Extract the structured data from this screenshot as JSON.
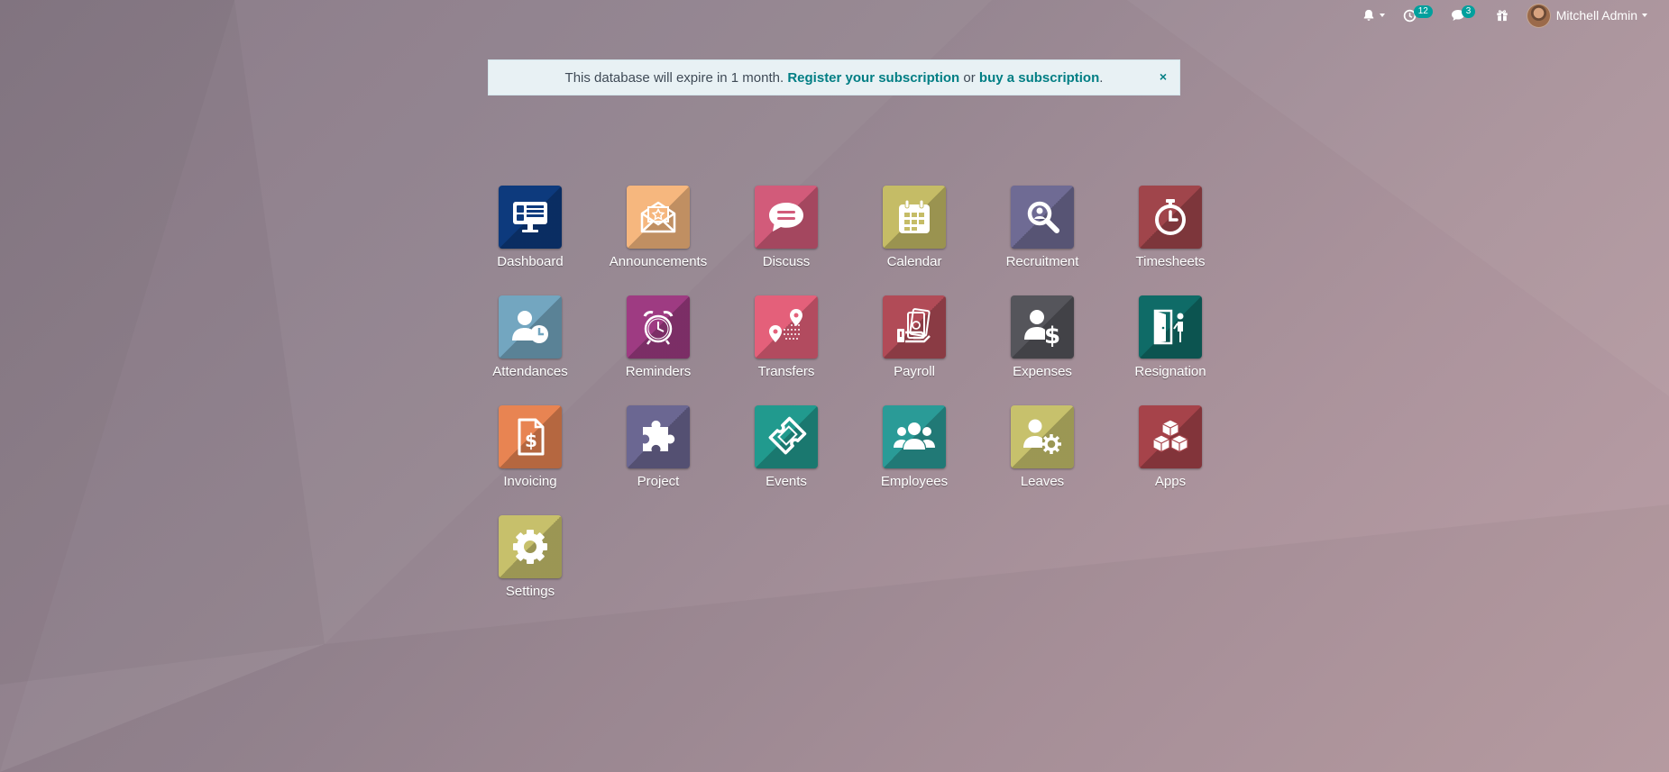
{
  "topbar": {
    "notifications_icon": "bell-icon",
    "activities_icon": "clock-icon",
    "activities_count": "12",
    "messages_icon": "chat-icon",
    "messages_count": "3",
    "gift_icon": "gift-icon",
    "user_name": "Mitchell Admin"
  },
  "alert": {
    "text_before": "This database will expire in 1 month.",
    "register_link": "Register your subscription",
    "text_or": "or",
    "buy_link": "buy a subscription",
    "text_after": ".",
    "close": "×"
  },
  "apps": [
    {
      "label": "Dashboard",
      "icon": "dashboard-icon",
      "color": "#0d3a7d"
    },
    {
      "label": "Announcements",
      "icon": "announcement-icon",
      "color": "#f6b77e"
    },
    {
      "label": "Discuss",
      "icon": "discuss-icon",
      "color": "#d25b7a"
    },
    {
      "label": "Calendar",
      "icon": "calendar-icon",
      "color": "#c5bc66"
    },
    {
      "label": "Recruitment",
      "icon": "recruitment-icon",
      "color": "#6f6b94"
    },
    {
      "label": "Timesheets",
      "icon": "stopwatch-icon",
      "color": "#a0454b"
    },
    {
      "label": "Attendances",
      "icon": "attendance-icon",
      "color": "#73a6c0"
    },
    {
      "label": "Reminders",
      "icon": "alarm-clock-icon",
      "color": "#9e3b82"
    },
    {
      "label": "Transfers",
      "icon": "transfer-icon",
      "color": "#e4607a"
    },
    {
      "label": "Payroll",
      "icon": "payroll-icon",
      "color": "#b14b57"
    },
    {
      "label": "Expenses",
      "icon": "expenses-icon",
      "color": "#55555b"
    },
    {
      "label": "Resignation",
      "icon": "resignation-icon",
      "color": "#0f6b67"
    },
    {
      "label": "Invoicing",
      "icon": "invoice-icon",
      "color": "#e88452"
    },
    {
      "label": "Project",
      "icon": "puzzle-icon",
      "color": "#6b6792"
    },
    {
      "label": "Events",
      "icon": "ticket-icon",
      "color": "#219a8e"
    },
    {
      "label": "Employees",
      "icon": "employees-icon",
      "color": "#2a9b97"
    },
    {
      "label": "Leaves",
      "icon": "leaves-icon",
      "color": "#c7c16c"
    },
    {
      "label": "Apps",
      "icon": "cubes-icon",
      "color": "#a6434a"
    },
    {
      "label": "Settings",
      "icon": "gear-icon",
      "color": "#c7c06b"
    }
  ]
}
